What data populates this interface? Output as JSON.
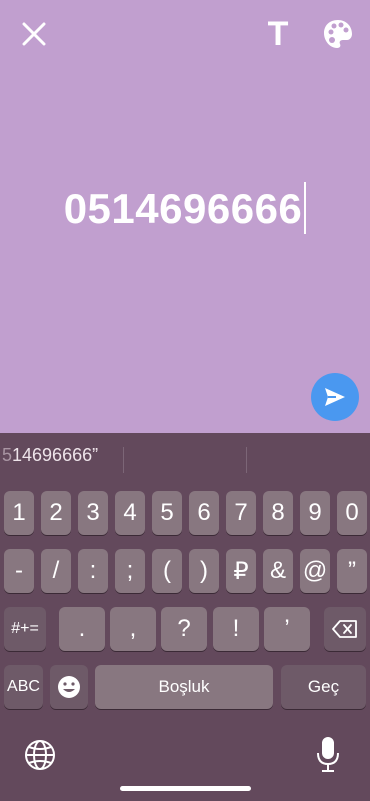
{
  "story": {
    "text": "0514696666"
  },
  "toolbar": {
    "text_label": "T"
  },
  "suggestion": {
    "prefix": "5",
    "rest": "14696666”"
  },
  "keyboard": {
    "row1": [
      "1",
      "2",
      "3",
      "4",
      "5",
      "6",
      "7",
      "8",
      "9",
      "0"
    ],
    "row2": [
      "-",
      "/",
      ":",
      ";",
      "(",
      ")",
      "₽",
      "&",
      "@",
      "”"
    ],
    "row3": [
      ".",
      ",",
      "?",
      "!",
      "’"
    ],
    "symbols_label": "#+=",
    "abc_label": "ABC",
    "space_label": "Boşluk",
    "return_label": "Geç"
  },
  "colors": {
    "background": "#c19fcf",
    "keyboard": "#63495c",
    "send": "#4a98f0"
  }
}
